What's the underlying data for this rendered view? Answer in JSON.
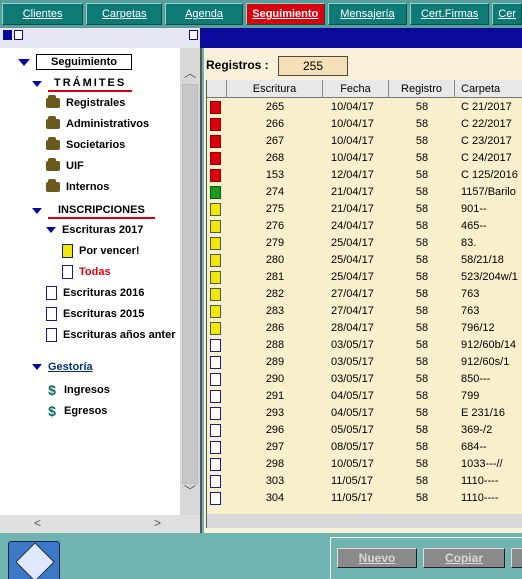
{
  "tabs": [
    {
      "label": "Clientes",
      "active": false
    },
    {
      "label": "Carpetas",
      "active": false
    },
    {
      "label": "Agenda",
      "active": false
    },
    {
      "label": "Seguimiento",
      "active": true
    },
    {
      "label": "Mensajería",
      "active": false
    },
    {
      "label": "Cert.Firmas",
      "active": false
    },
    {
      "label": "Cer",
      "active": false
    }
  ],
  "tree": {
    "root_label": "Seguimiento",
    "tramites_header": "TRÁMITES",
    "tramites_items": [
      "Registrales",
      "Administrativos",
      "Societarios",
      "UIF",
      "Internos"
    ],
    "inscripciones_header": "INSCRIPCIONES",
    "escrituras_2017": "Escrituras 2017",
    "por_vencer": "Por vencer!",
    "todas": "Todas",
    "escrituras_2016": "Escrituras 2016",
    "escrituras_2015": "Escrituras 2015",
    "escrituras_anteriores": "Escrituras años anter",
    "gestoria": "Gestoría",
    "ingresos": "Ingresos",
    "egresos": "Egresos"
  },
  "registros": {
    "label": "Registros :",
    "count": "255"
  },
  "columns": [
    "Escritura",
    "Fecha",
    "Registro",
    "Carpeta"
  ],
  "rows": [
    {
      "status": "red",
      "escritura": "265",
      "fecha": "10/04/17",
      "registro": "58",
      "carpeta": "C 21/2017"
    },
    {
      "status": "red",
      "escritura": "266",
      "fecha": "10/04/17",
      "registro": "58",
      "carpeta": "C 22/2017"
    },
    {
      "status": "red",
      "escritura": "267",
      "fecha": "10/04/17",
      "registro": "58",
      "carpeta": "C 23/2017"
    },
    {
      "status": "red",
      "escritura": "268",
      "fecha": "10/04/17",
      "registro": "58",
      "carpeta": "C 24/2017"
    },
    {
      "status": "red",
      "escritura": "153",
      "fecha": "12/04/17",
      "registro": "58",
      "carpeta": "C 125/2016"
    },
    {
      "status": "green",
      "escritura": "274",
      "fecha": "21/04/17",
      "registro": "58",
      "carpeta": "1157/Barilo"
    },
    {
      "status": "yellow",
      "escritura": "275",
      "fecha": "21/04/17",
      "registro": "58",
      "carpeta": "901--"
    },
    {
      "status": "yellow",
      "escritura": "276",
      "fecha": "24/04/17",
      "registro": "58",
      "carpeta": "465--"
    },
    {
      "status": "yellow",
      "escritura": "279",
      "fecha": "25/04/17",
      "registro": "58",
      "carpeta": "83."
    },
    {
      "status": "yellow",
      "escritura": "280",
      "fecha": "25/04/17",
      "registro": "58",
      "carpeta": "58/21/18"
    },
    {
      "status": "yellow",
      "escritura": "281",
      "fecha": "25/04/17",
      "registro": "58",
      "carpeta": "523/204w/1"
    },
    {
      "status": "yellow",
      "escritura": "282",
      "fecha": "27/04/17",
      "registro": "58",
      "carpeta": "763"
    },
    {
      "status": "yellow",
      "escritura": "283",
      "fecha": "27/04/17",
      "registro": "58",
      "carpeta": "763"
    },
    {
      "status": "yellow",
      "escritura": "286",
      "fecha": "28/04/17",
      "registro": "58",
      "carpeta": "796/12"
    },
    {
      "status": "white",
      "escritura": "288",
      "fecha": "03/05/17",
      "registro": "58",
      "carpeta": "912/60b/14"
    },
    {
      "status": "white",
      "escritura": "289",
      "fecha": "03/05/17",
      "registro": "58",
      "carpeta": "912/60s/1"
    },
    {
      "status": "white",
      "escritura": "290",
      "fecha": "03/05/17",
      "registro": "58",
      "carpeta": "850---"
    },
    {
      "status": "white",
      "escritura": "291",
      "fecha": "04/05/17",
      "registro": "58",
      "carpeta": "799"
    },
    {
      "status": "white",
      "escritura": "293",
      "fecha": "04/05/17",
      "registro": "58",
      "carpeta": "E 231/16"
    },
    {
      "status": "white",
      "escritura": "296",
      "fecha": "05/05/17",
      "registro": "58",
      "carpeta": "369-/2"
    },
    {
      "status": "white",
      "escritura": "297",
      "fecha": "08/05/17",
      "registro": "58",
      "carpeta": "684--"
    },
    {
      "status": "white",
      "escritura": "298",
      "fecha": "10/05/17",
      "registro": "58",
      "carpeta": "1033---//"
    },
    {
      "status": "white",
      "escritura": "303",
      "fecha": "11/05/17",
      "registro": "58",
      "carpeta": "1110----"
    },
    {
      "status": "white",
      "escritura": "304",
      "fecha": "11/05/17",
      "registro": "58",
      "carpeta": "1110----"
    }
  ],
  "buttons": {
    "nuevo": "Nuevo",
    "copiar": "Copiar"
  }
}
